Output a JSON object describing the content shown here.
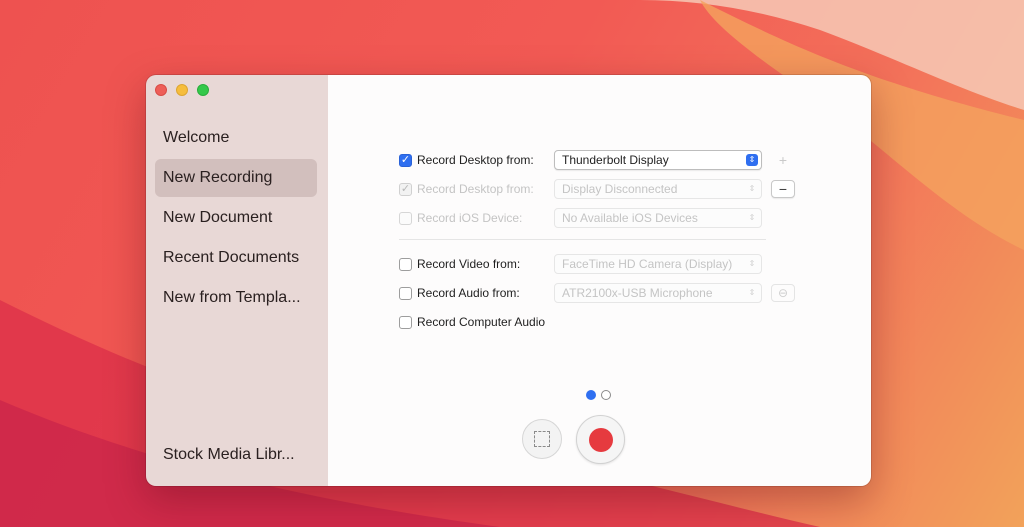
{
  "sidebar": {
    "items": [
      {
        "label": "Welcome"
      },
      {
        "label": "New Recording"
      },
      {
        "label": "New Document"
      },
      {
        "label": "Recent Documents"
      },
      {
        "label": "New from Templa..."
      }
    ],
    "selected_index": 1,
    "bottom_item": "Stock Media Libr..."
  },
  "recording": {
    "desktop_1": {
      "label": "Record Desktop from:",
      "checked": true,
      "enabled": true,
      "value": "Thunderbolt Display",
      "action": "+"
    },
    "desktop_2": {
      "label": "Record Desktop from:",
      "checked": true,
      "enabled": false,
      "value": "Display Disconnected",
      "action": "−"
    },
    "ios": {
      "label": "Record iOS Device:",
      "checked": false,
      "enabled": false,
      "value": "No Available iOS Devices"
    },
    "video": {
      "label": "Record Video from:",
      "checked": false,
      "enabled": true,
      "value": "FaceTime HD Camera (Display)"
    },
    "audio": {
      "label": "Record Audio from:",
      "checked": false,
      "enabled": true,
      "value": "ATR2100x-USB Microphone",
      "action": "⊖"
    },
    "computer_audio": {
      "label": "Record Computer Audio",
      "checked": false,
      "enabled": true
    }
  },
  "pager": {
    "pages": 2,
    "current": 1
  },
  "colors": {
    "accent": "#2f6ff0",
    "record": "#e63a3f",
    "sidebar_bg": "#e8d8d6",
    "sidebar_selected": "#d2bfbd"
  },
  "icons": {
    "close": "close-icon",
    "minimize": "minimize-icon",
    "zoom": "zoom-icon",
    "select_area": "selection-area-icon",
    "record": "record-icon"
  }
}
